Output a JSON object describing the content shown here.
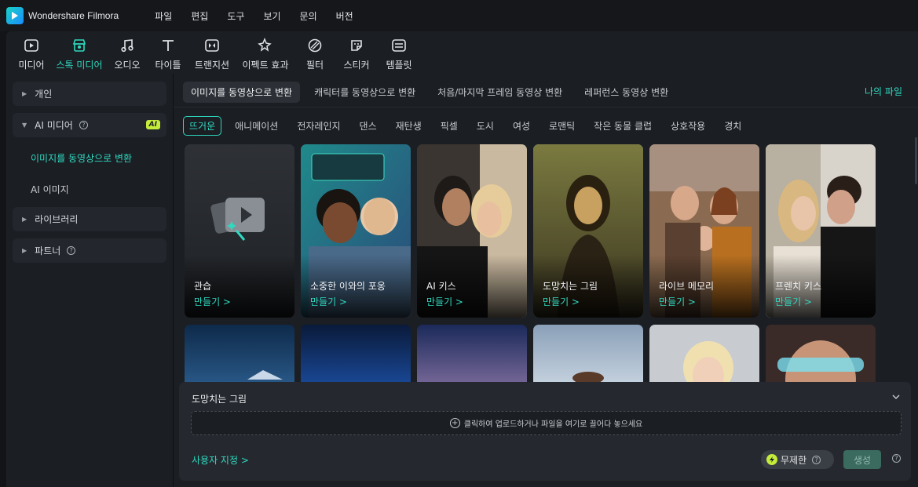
{
  "app": {
    "name": "Wondershare Filmora",
    "menu": [
      "파일",
      "편집",
      "도구",
      "보기",
      "문의",
      "버전"
    ]
  },
  "toolbar": {
    "items": [
      {
        "label": "미디어",
        "icon": "media-icon"
      },
      {
        "label": "스톡 미디어",
        "icon": "stock-media-icon"
      },
      {
        "label": "오디오",
        "icon": "audio-icon"
      },
      {
        "label": "타이틀",
        "icon": "title-icon"
      },
      {
        "label": "트랜지션",
        "icon": "transition-icon"
      },
      {
        "label": "이펙트 효과",
        "icon": "effects-icon"
      },
      {
        "label": "필터",
        "icon": "filter-icon"
      },
      {
        "label": "스티커",
        "icon": "sticker-icon"
      },
      {
        "label": "템플릿",
        "icon": "template-icon"
      }
    ],
    "active_index": 1
  },
  "sidebar": {
    "items": [
      {
        "label": "개인"
      },
      {
        "label": "AI 미디어",
        "badge": "AI"
      },
      {
        "label": "라이브러리"
      },
      {
        "label": "파트너"
      }
    ],
    "sub_items": [
      {
        "label": "이미지를 동영상으로 변환",
        "active": true
      },
      {
        "label": "AI 이미지",
        "active": false
      }
    ]
  },
  "main": {
    "tabs": [
      "이미지를 동영상으로 변환",
      "캐릭터를 동영상으로 변환",
      "처음/마지막 프레임 동영상 변환",
      "레퍼런스 동영상 변환"
    ],
    "my_files": "나의 파일",
    "categories": [
      "뜨거운",
      "애니메이션",
      "전자레인지",
      "댄스",
      "재탄생",
      "픽셀",
      "도시",
      "여성",
      "로맨틱",
      "작은 동물 클럽",
      "상호작용",
      "경치"
    ],
    "cards": [
      {
        "title": "관습",
        "action": "만들기 >"
      },
      {
        "title": "소중한 이와의 포옹",
        "action": "만들기 >"
      },
      {
        "title": "AI 키스",
        "action": "만들기 >"
      },
      {
        "title": "도망치는 그림",
        "action": "만들기 >"
      },
      {
        "title": "라이브 메모리",
        "action": "만들기 >"
      },
      {
        "title": "프렌치 키스",
        "action": "만들기 >"
      }
    ]
  },
  "panel": {
    "title": "도망치는 그림",
    "upload_text": "클릭하여 업로드하거나 파일을 여기로 끌어다 놓으세요",
    "custom_link": "사용자 지정 >",
    "unlimited": "무제한",
    "generate": "생성"
  },
  "colors": {
    "accent": "#2fd9c0",
    "ai_badge": "#c4ec3a",
    "background": "#121417",
    "panel": "#1b1e23"
  }
}
